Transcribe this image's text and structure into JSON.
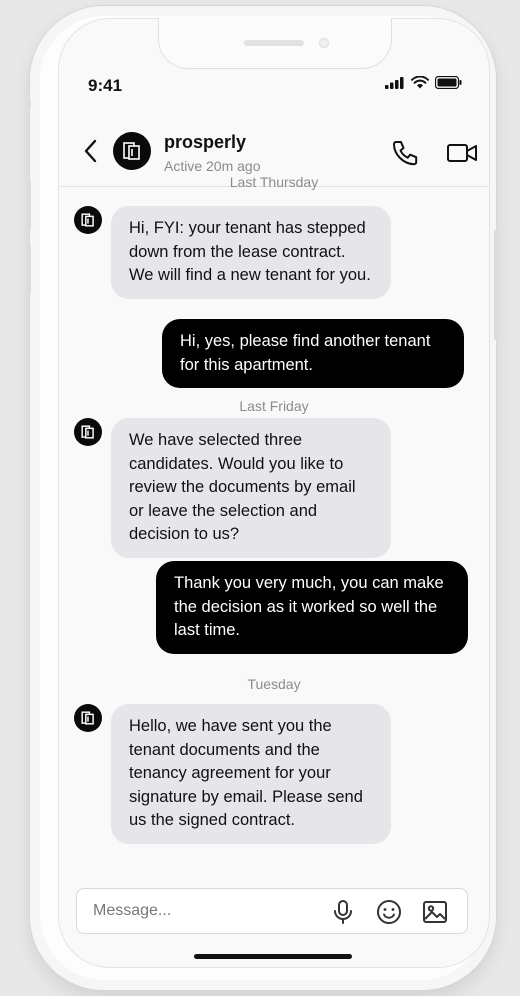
{
  "status_bar": {
    "time": "9:41"
  },
  "header": {
    "name": "prosperly",
    "status": "Active 20m ago"
  },
  "messages": [
    {
      "type": "divider",
      "text": "Last Thursday"
    },
    {
      "type": "incoming",
      "text": "Hi, FYI: your tenant has stepped down from the lease contract. We will find a new tenant for you."
    },
    {
      "type": "outgoing",
      "text": "Hi, yes, please find another tenant for this apartment."
    },
    {
      "type": "divider",
      "text": "Last Friday"
    },
    {
      "type": "incoming",
      "text": "We have selected three candidates. Would you like to review the documents by email or leave the selection and decision to us?"
    },
    {
      "type": "outgoing",
      "text": "Thank you very much, you can make the decision as it worked so well the last time."
    },
    {
      "type": "divider",
      "text": "Tuesday"
    },
    {
      "type": "incoming",
      "text": "Hello, we have sent you the tenant documents and the tenancy agreement for your signature by email. Please send us the signed contract."
    }
  ],
  "composer": {
    "placeholder": "Message..."
  },
  "icons": {
    "back": "chevron-left-icon",
    "call": "phone-icon",
    "video": "video-camera-icon",
    "mic": "microphone-icon",
    "emoji": "smiley-icon",
    "gallery": "image-icon"
  },
  "colors": {
    "incoming_bubble": "#e5e5ea",
    "outgoing_bubble": "#000000",
    "avatar": "#0a0a0a"
  }
}
